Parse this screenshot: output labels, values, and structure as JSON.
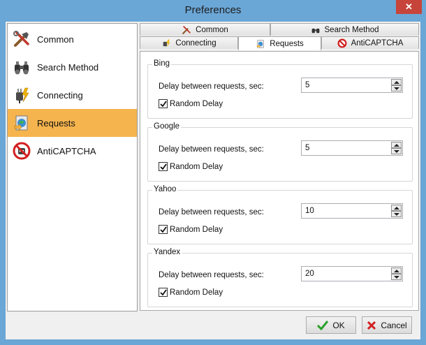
{
  "window": {
    "title": "Preferences",
    "close_label": "✕"
  },
  "sidebar": {
    "items": [
      {
        "label": "Common",
        "icon": "tools-icon",
        "selected": false
      },
      {
        "label": "Search Method",
        "icon": "binoculars-icon",
        "selected": false
      },
      {
        "label": "Connecting",
        "icon": "plug-icon",
        "selected": false
      },
      {
        "label": "Requests",
        "icon": "requests-icon",
        "selected": true
      },
      {
        "label": "AntiCAPTCHA",
        "icon": "no-robot-icon",
        "selected": false
      }
    ]
  },
  "tabs": {
    "row1": [
      {
        "label": "Common",
        "icon": "tools-icon"
      },
      {
        "label": "Search Method",
        "icon": "binoculars-icon"
      }
    ],
    "row2": [
      {
        "label": "Connecting",
        "icon": "plug-icon"
      },
      {
        "label": "Requests",
        "icon": "requests-icon",
        "active": true
      },
      {
        "label": "AntiCAPTCHA",
        "icon": "no-robot-icon"
      }
    ]
  },
  "groups": [
    {
      "title": "Bing",
      "delay_label": "Delay between requests, sec:",
      "delay_value": "5",
      "random_label": "Random Delay",
      "random_checked": true
    },
    {
      "title": "Google",
      "delay_label": "Delay between requests, sec:",
      "delay_value": "5",
      "random_label": "Random Delay",
      "random_checked": true
    },
    {
      "title": "Yahoo",
      "delay_label": "Delay between requests, sec:",
      "delay_value": "10",
      "random_label": "Random Delay",
      "random_checked": true
    },
    {
      "title": "Yandex",
      "delay_label": "Delay between requests, sec:",
      "delay_value": "20",
      "random_label": "Random Delay",
      "random_checked": true
    }
  ],
  "buttons": {
    "ok": "OK",
    "cancel": "Cancel"
  },
  "colors": {
    "accent_selected": "#f5b44d",
    "title_bar": "#6aa6d6",
    "close": "#c7443a"
  }
}
